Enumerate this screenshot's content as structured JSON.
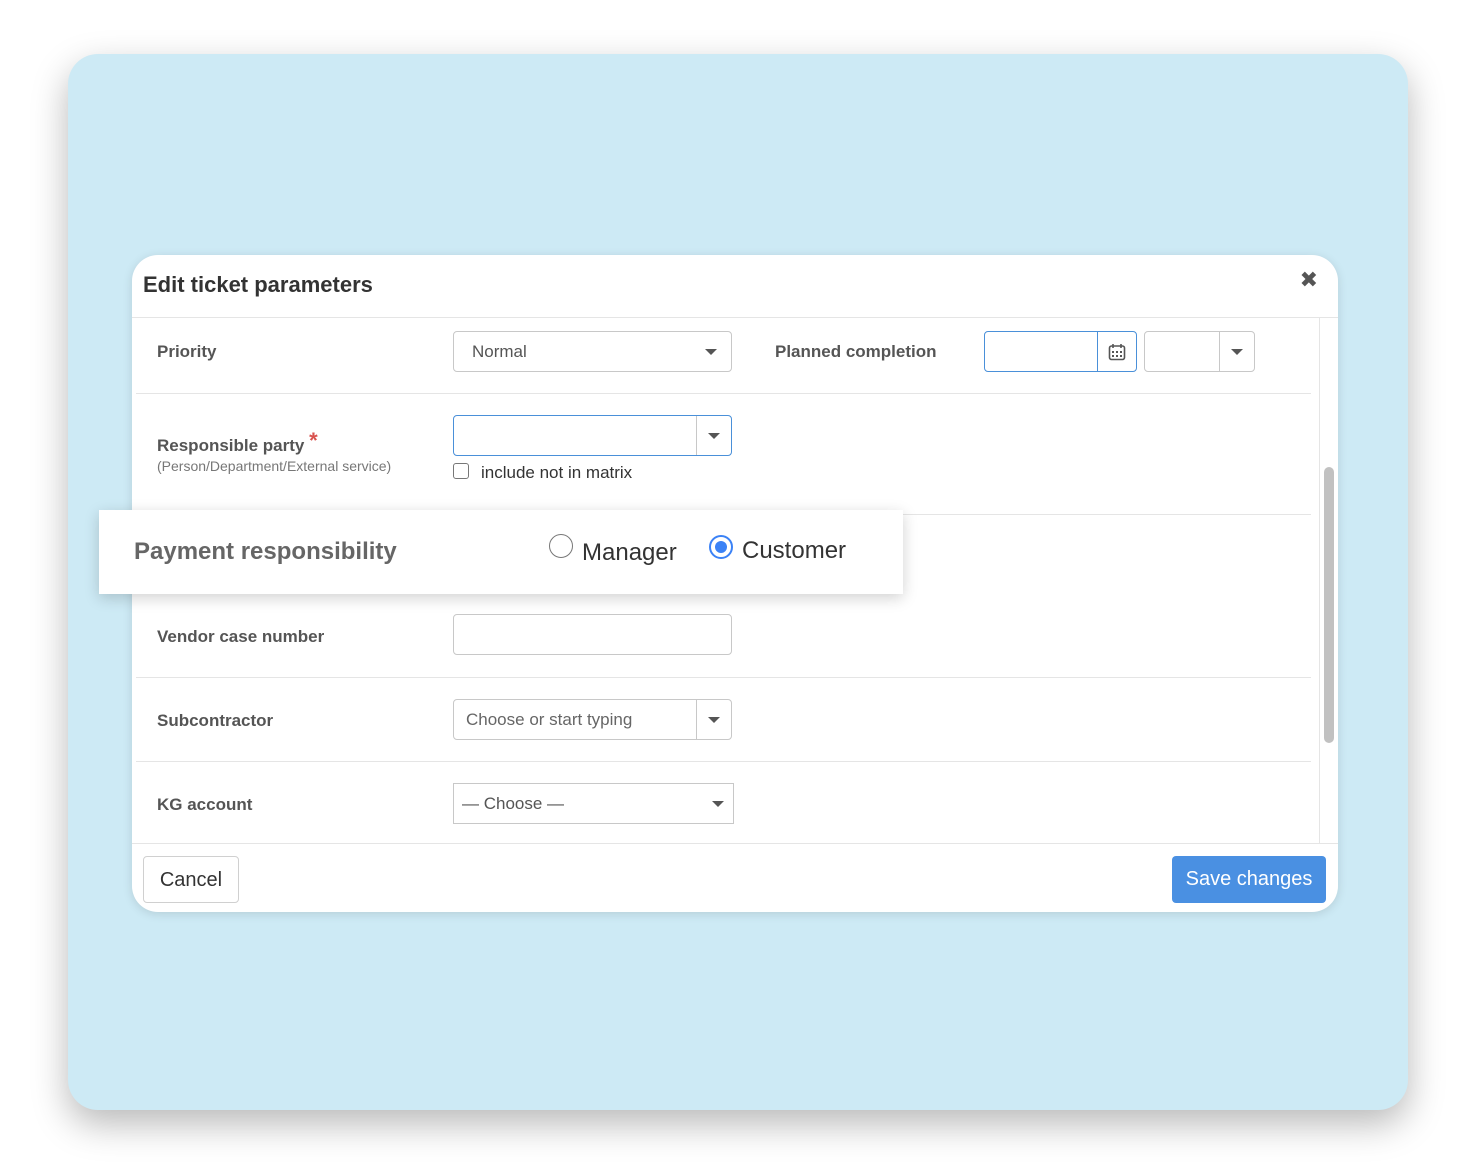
{
  "modal": {
    "title": "Edit ticket parameters",
    "close_glyph": "✖"
  },
  "priority": {
    "label": "Priority",
    "value": "Normal"
  },
  "planned_completion": {
    "label": "Planned completion",
    "date_value": "",
    "time_value": ""
  },
  "responsible_party": {
    "label": "Responsible party",
    "required_mark": "*",
    "hint": "(Person/Department/External service)",
    "value": "",
    "checkbox_label": "include not in matrix",
    "checkbox_checked": false
  },
  "payment_responsibility": {
    "label": "Payment responsibility",
    "options": [
      "Manager",
      "Customer"
    ],
    "selected": "Customer"
  },
  "vendor_case_number": {
    "label": "Vendor case number",
    "value": ""
  },
  "subcontractor": {
    "label": "Subcontractor",
    "placeholder": "Choose or start typing"
  },
  "kg_account": {
    "label": "KG account",
    "value": "— Choose —"
  },
  "footer": {
    "cancel_label": "Cancel",
    "save_label": "Save changes"
  },
  "colors": {
    "background": "#cdeaf5",
    "accent": "#4a90e2",
    "required": "#d9534f"
  }
}
